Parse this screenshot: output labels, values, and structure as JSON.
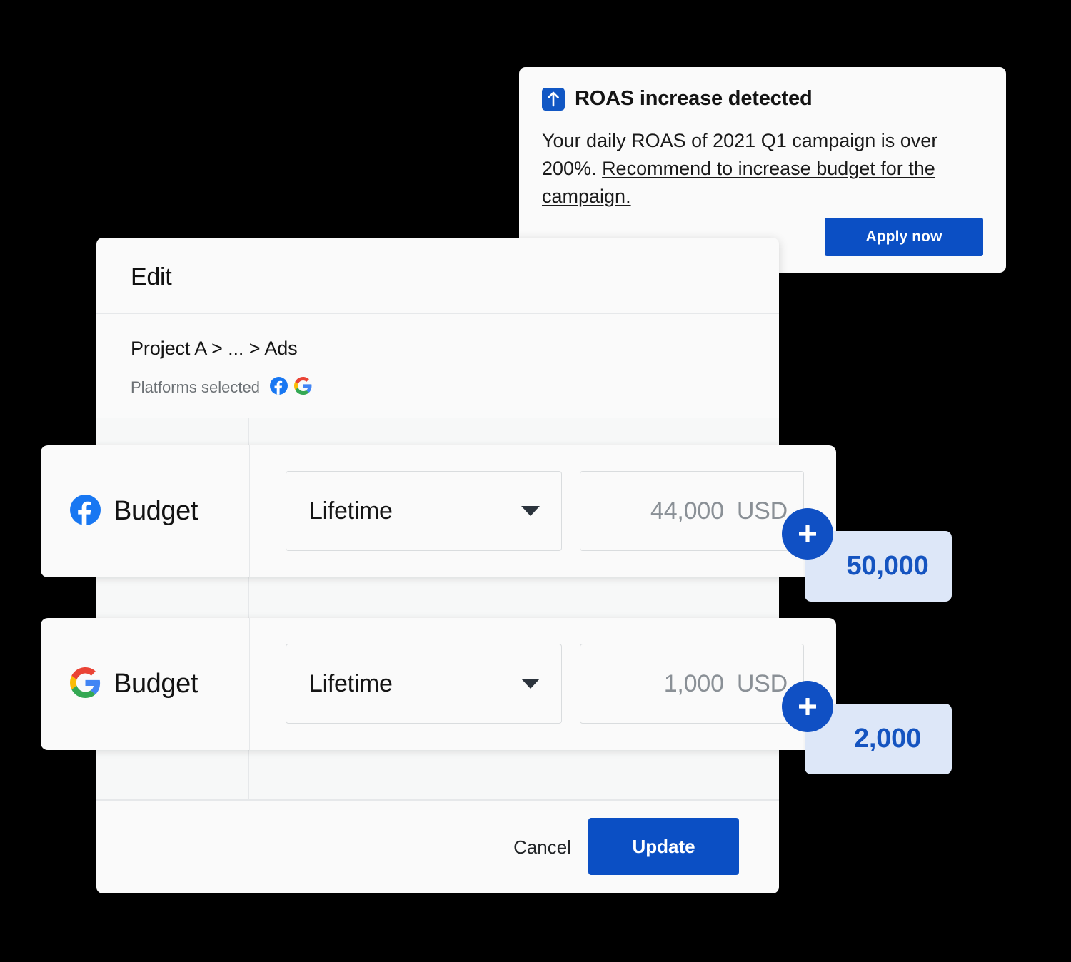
{
  "notification": {
    "icon": "arrow-up-boxed-icon",
    "title": "ROAS increase detected",
    "body_lead": "Your daily ROAS of 2021 Q1 campaign is over 200%. ",
    "body_link": "Recommend to increase budget for the campaign.",
    "apply_label": "Apply now",
    "accent_color": "#0B4FC4",
    "icon_bg_color": "#1157C4"
  },
  "dialog": {
    "title": "Edit",
    "breadcrumb": "Project A > ... > Ads",
    "platforms_label": "Platforms selected",
    "platforms": [
      "facebook-icon",
      "google-icon"
    ],
    "cancel_label": "Cancel",
    "update_label": "Update",
    "update_color": "#0B4FC4"
  },
  "budget_rows": [
    {
      "platform": "facebook",
      "platform_icon": "facebook-icon",
      "label": "Budget",
      "select_value": "Lifetime",
      "amount": "44,000",
      "currency": "USD",
      "suggested_value": "50,000",
      "badge_bg_color": "#DDE7F8",
      "badge_text_color": "#1554C0",
      "plus_color": "#1050C4"
    },
    {
      "platform": "google",
      "platform_icon": "google-icon",
      "label": "Budget",
      "select_value": "Lifetime",
      "amount": "1,000",
      "currency": "USD",
      "suggested_value": "2,000",
      "badge_bg_color": "#DDE7F8",
      "badge_text_color": "#1554C0",
      "plus_color": "#1050C4"
    }
  ]
}
